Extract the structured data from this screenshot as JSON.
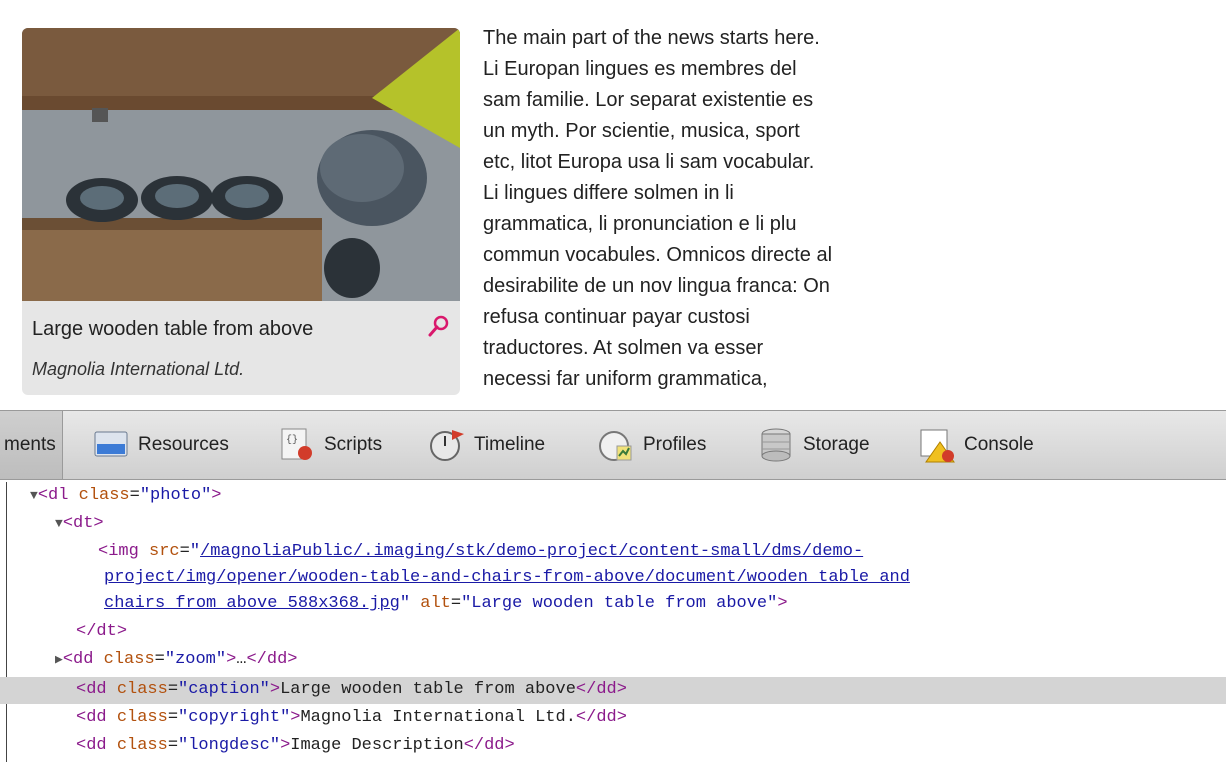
{
  "article": {
    "caption": "Large wooden table from above",
    "copyright": "Magnolia International Ltd.",
    "news_lines": [
      "The main part of the news starts here.",
      "Li Europan lingues es membres del",
      "sam familie. Lor separat existentie es",
      "un myth. Por scientie, musica, sport",
      "etc, litot Europa usa li sam vocabular.",
      "Li lingues differe solmen in li",
      "grammatica, li pronunciation e li plu",
      "commun vocabules. Omnicos directe al",
      "desirabilite de un nov lingua franca: On",
      "refusa continuar payar custosi",
      "traductores. At solmen va esser",
      "necessi far uniform grammatica,"
    ]
  },
  "devtools": {
    "tabs": [
      {
        "label": "ments",
        "icon": "elements-icon"
      },
      {
        "label": "Resources",
        "icon": "resources-icon"
      },
      {
        "label": "Scripts",
        "icon": "scripts-icon"
      },
      {
        "label": "Timeline",
        "icon": "timeline-icon"
      },
      {
        "label": "Profiles",
        "icon": "profiles-icon"
      },
      {
        "label": "Storage",
        "icon": "storage-icon"
      },
      {
        "label": "Console",
        "icon": "console-icon"
      }
    ],
    "code": {
      "dl_tag": "dl",
      "dl_class": "photo",
      "dt_tag": "dt",
      "img_src_line1": "/magnoliaPublic/.imaging/stk/demo-project/content-small/dms/demo-",
      "img_src_line2": "project/img/opener/wooden-table-and-chairs-from-above/document/wooden table and",
      "img_src_line3": "chairs from above 588x368.jpg",
      "img_alt": "Large wooden table from above",
      "zoom_class": "zoom",
      "zoom_ellipsis": "…",
      "caption_class": "caption",
      "caption_text": "Large wooden table from above",
      "copyright_class": "copyright",
      "copyright_text": "Magnolia International Ltd.",
      "longdesc_class": "longdesc",
      "longdesc_text": "Image Description"
    },
    "colors": {
      "tag": "#8b1a8b",
      "attr": "#b2510e",
      "value": "#1a1aa6",
      "highlight": "#d4d4d4"
    }
  }
}
